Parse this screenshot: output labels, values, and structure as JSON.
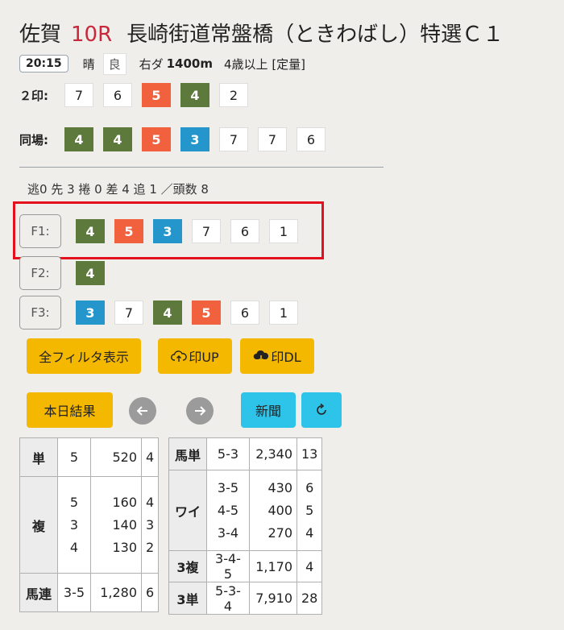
{
  "header": {
    "venue": "佐賀",
    "race_no": "10R",
    "race_name": "長崎街道常盤橋（ときわばし）特選Ｃ１",
    "time": "20:15",
    "weather": "晴",
    "track": "良",
    "course": "右ダ",
    "distance": "1400m",
    "conditions": "4歳以上 [定量]"
  },
  "rows": {
    "nijirushi": {
      "label": "２印:",
      "nums": [
        "7",
        "6",
        "5",
        "4",
        "2"
      ]
    },
    "doujo": {
      "label": "同場:",
      "nums": [
        "4",
        "4",
        "5",
        "3",
        "7",
        "7",
        "6"
      ]
    }
  },
  "runstyle": {
    "text": "逃0 先 3 捲 0 差 4 追 1 ／頭数 8"
  },
  "filters": [
    {
      "label": "F1:",
      "nums": [
        "4",
        "5",
        "3",
        "7",
        "6",
        "1"
      ]
    },
    {
      "label": "F2:",
      "nums": [
        "4"
      ]
    },
    {
      "label": "F3:",
      "nums": [
        "3",
        "7",
        "4",
        "5",
        "6",
        "1"
      ]
    }
  ],
  "buttons": {
    "all_filter": "全フィルタ表示",
    "mark_up": "印UP",
    "mark_dl": "印DL",
    "today_results": "本日結果",
    "newspaper": "新聞"
  },
  "payout_left": {
    "tan": {
      "label": "単",
      "combo": "5",
      "amount": "520",
      "pop": "4"
    },
    "fuku": {
      "label": "複",
      "combos": [
        "5",
        "3",
        "4"
      ],
      "amounts": [
        "160",
        "140",
        "130"
      ],
      "pops": [
        "4",
        "3",
        "2"
      ]
    },
    "umaren": {
      "label": "馬連",
      "combo": "3-5",
      "amount": "1,280",
      "pop": "6"
    }
  },
  "payout_right": {
    "umatan": {
      "label": "馬単",
      "combo": "5-3",
      "amount": "2,340",
      "pop": "13"
    },
    "wide": {
      "label": "ワイ",
      "combos": [
        "3-5",
        "4-5",
        "3-4"
      ],
      "amounts": [
        "430",
        "400",
        "270"
      ],
      "pops": [
        "6",
        "5",
        "4"
      ]
    },
    "sanfuku": {
      "label": "3複",
      "combo": "3-4-5",
      "amount": "1,170",
      "pop": "4"
    },
    "santan": {
      "label": "3単",
      "combo": "5-3-4",
      "amount": "7,910",
      "pop": "28"
    }
  },
  "colors": {
    "green": "#5d7a3c",
    "red": "#f2613e",
    "blue": "#2496cc",
    "yellow": "#f5b800",
    "cyan": "#2ec4ea",
    "race": "#c9283b",
    "highlight": "#e5101e"
  }
}
